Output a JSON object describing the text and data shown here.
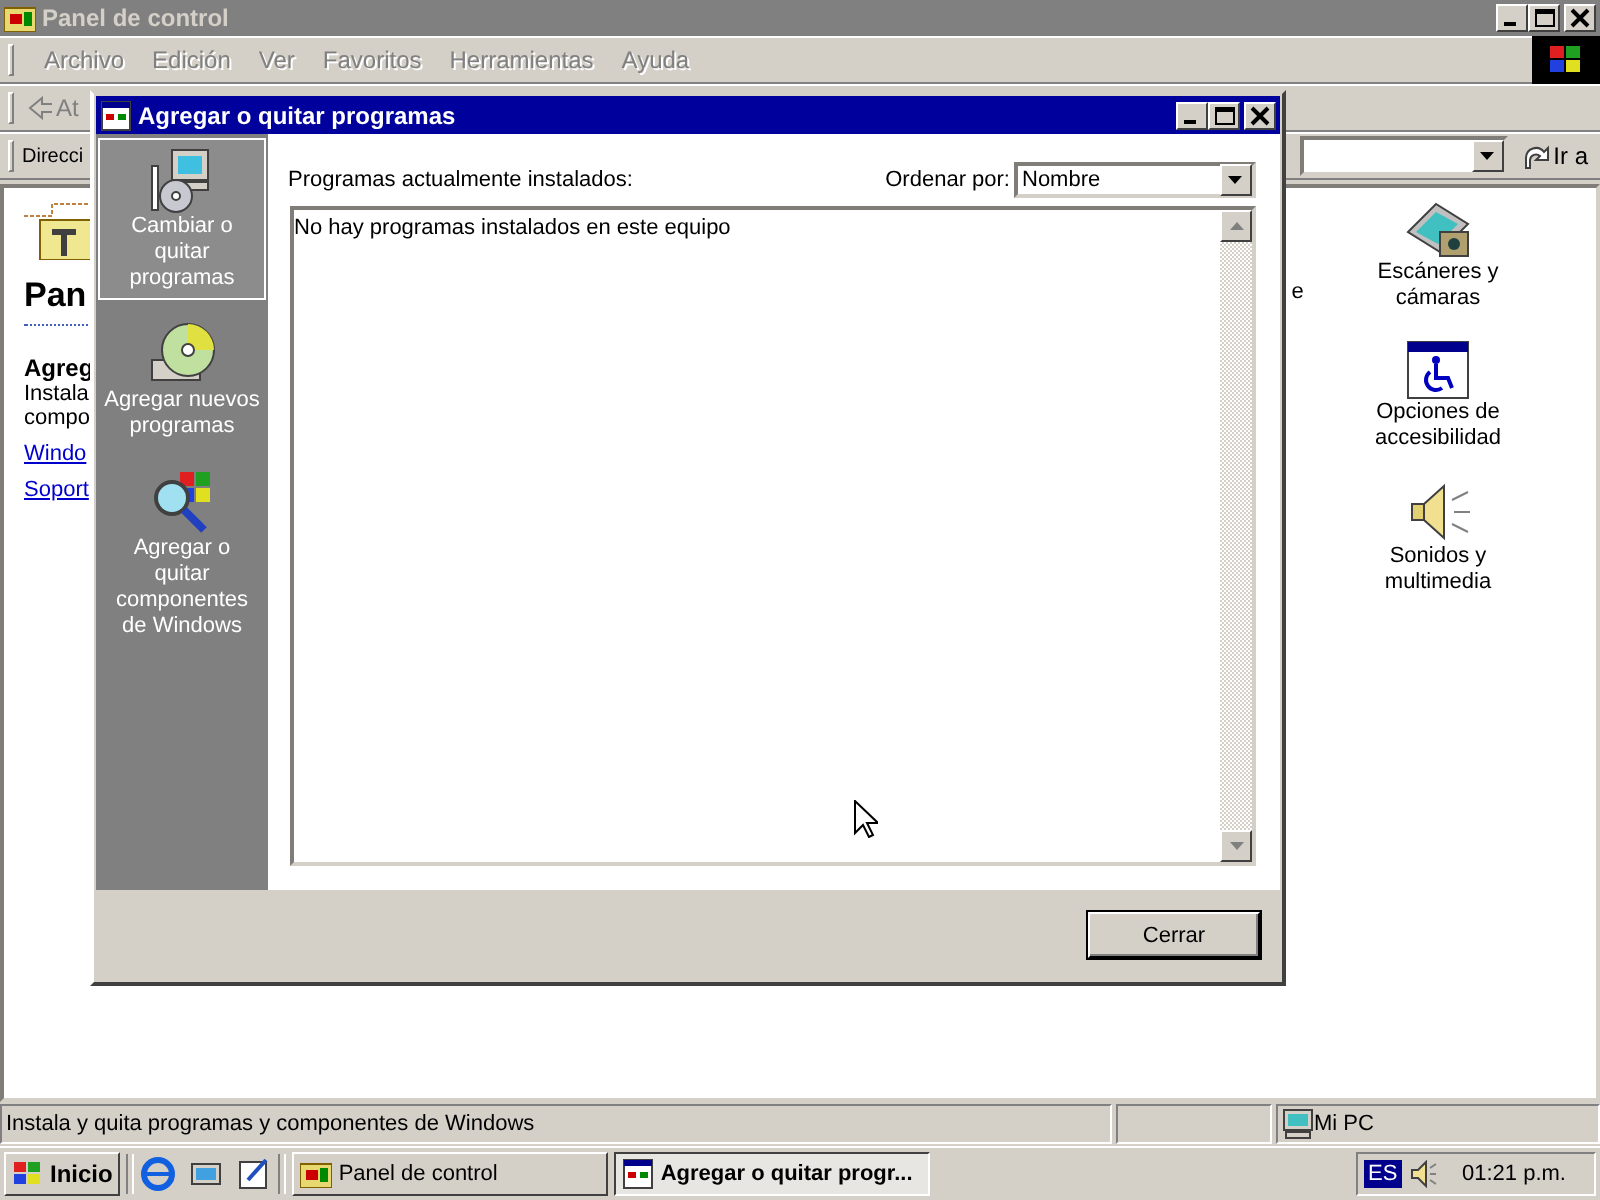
{
  "explorer_window": {
    "title": "Panel de control",
    "menu": [
      {
        "label": "Archivo",
        "disabled": true
      },
      {
        "label": "Edición",
        "disabled": true
      },
      {
        "label": "Ver",
        "disabled": true
      },
      {
        "label": "Favoritos",
        "disabled": true
      },
      {
        "label": "Herramientas",
        "disabled": true
      },
      {
        "label": "Ayuda",
        "disabled": true
      }
    ],
    "back_label": "At",
    "address_label": "Direcci",
    "go_button": "Ir a",
    "web_panel": {
      "heading": "Pan",
      "subheading": "Agreg",
      "text_lines": [
        "Instala",
        "compo"
      ],
      "links": [
        "Windo",
        "Soport"
      ]
    },
    "partial_label": "e",
    "icons": [
      {
        "kind": "scanner",
        "label_lines": [
          "Escáneres y",
          "cámaras"
        ]
      },
      {
        "kind": "accessibility",
        "label_lines": [
          "Opciones de",
          "accesibilidad"
        ]
      },
      {
        "kind": "sound",
        "label_lines": [
          "Sonidos y",
          "multimedia"
        ]
      }
    ],
    "status_bar": {
      "text": "Instala y quita programas y componentes de Windows",
      "zone": "Mi PC"
    }
  },
  "dialog": {
    "title": "Agregar o quitar programas",
    "tasks": [
      {
        "kind": "change",
        "label_lines": [
          "Cambiar o",
          "quitar",
          "programas"
        ],
        "selected": true
      },
      {
        "kind": "add",
        "label_lines": [
          "Agregar nuevos",
          "programas"
        ],
        "selected": false
      },
      {
        "kind": "components",
        "label_lines": [
          "Agregar o",
          "quitar",
          "componentes",
          "de Windows"
        ],
        "selected": false
      }
    ],
    "installed_label": "Programas actualmente instalados:",
    "sort_label": "Ordenar por:",
    "sort_value": "Nombre",
    "empty_message": "No hay programas instalados en este equipo",
    "close_button": "Cerrar"
  },
  "taskbar": {
    "start": "Inicio",
    "quick_launch": [
      {
        "kind": "browser"
      },
      {
        "kind": "desktop"
      },
      {
        "kind": "channels"
      }
    ],
    "tasks": [
      {
        "label": "Panel de control",
        "selected": false
      },
      {
        "label": "Agregar o quitar progr...",
        "selected": true
      }
    ],
    "language": "ES",
    "clock": "01:21 p.m."
  }
}
